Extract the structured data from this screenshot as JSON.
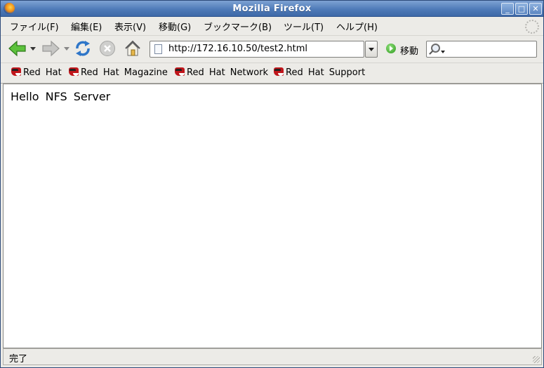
{
  "window": {
    "title": "Mozilla Firefox",
    "buttons": {
      "minimize": "_",
      "maximize": "□",
      "close": "✕"
    }
  },
  "menu": [
    {
      "label": "ファイル(F)"
    },
    {
      "label": "編集(E)"
    },
    {
      "label": "表示(V)"
    },
    {
      "label": "移動(G)"
    },
    {
      "label": "ブックマーク(B)"
    },
    {
      "label": "ツール(T)"
    },
    {
      "label": "ヘルプ(H)"
    }
  ],
  "nav": {
    "url": "http://172.16.10.50/test2.html",
    "go_label": "移動",
    "search_value": "",
    "icons": [
      "back-arrow-icon",
      "forward-arrow-icon",
      "reload-icon",
      "stop-icon",
      "home-icon"
    ]
  },
  "bookmarks": [
    {
      "label": "Red Hat"
    },
    {
      "label": "Red Hat Magazine"
    },
    {
      "label": "Red Hat Network"
    },
    {
      "label": "Red Hat Support"
    }
  ],
  "page": {
    "text": "Hello NFS Server"
  },
  "status": {
    "text": "完了"
  },
  "colors": {
    "titlebar": "#4f7bb8",
    "chrome": "#ecebe7",
    "redhat_red": "#c0161b"
  }
}
